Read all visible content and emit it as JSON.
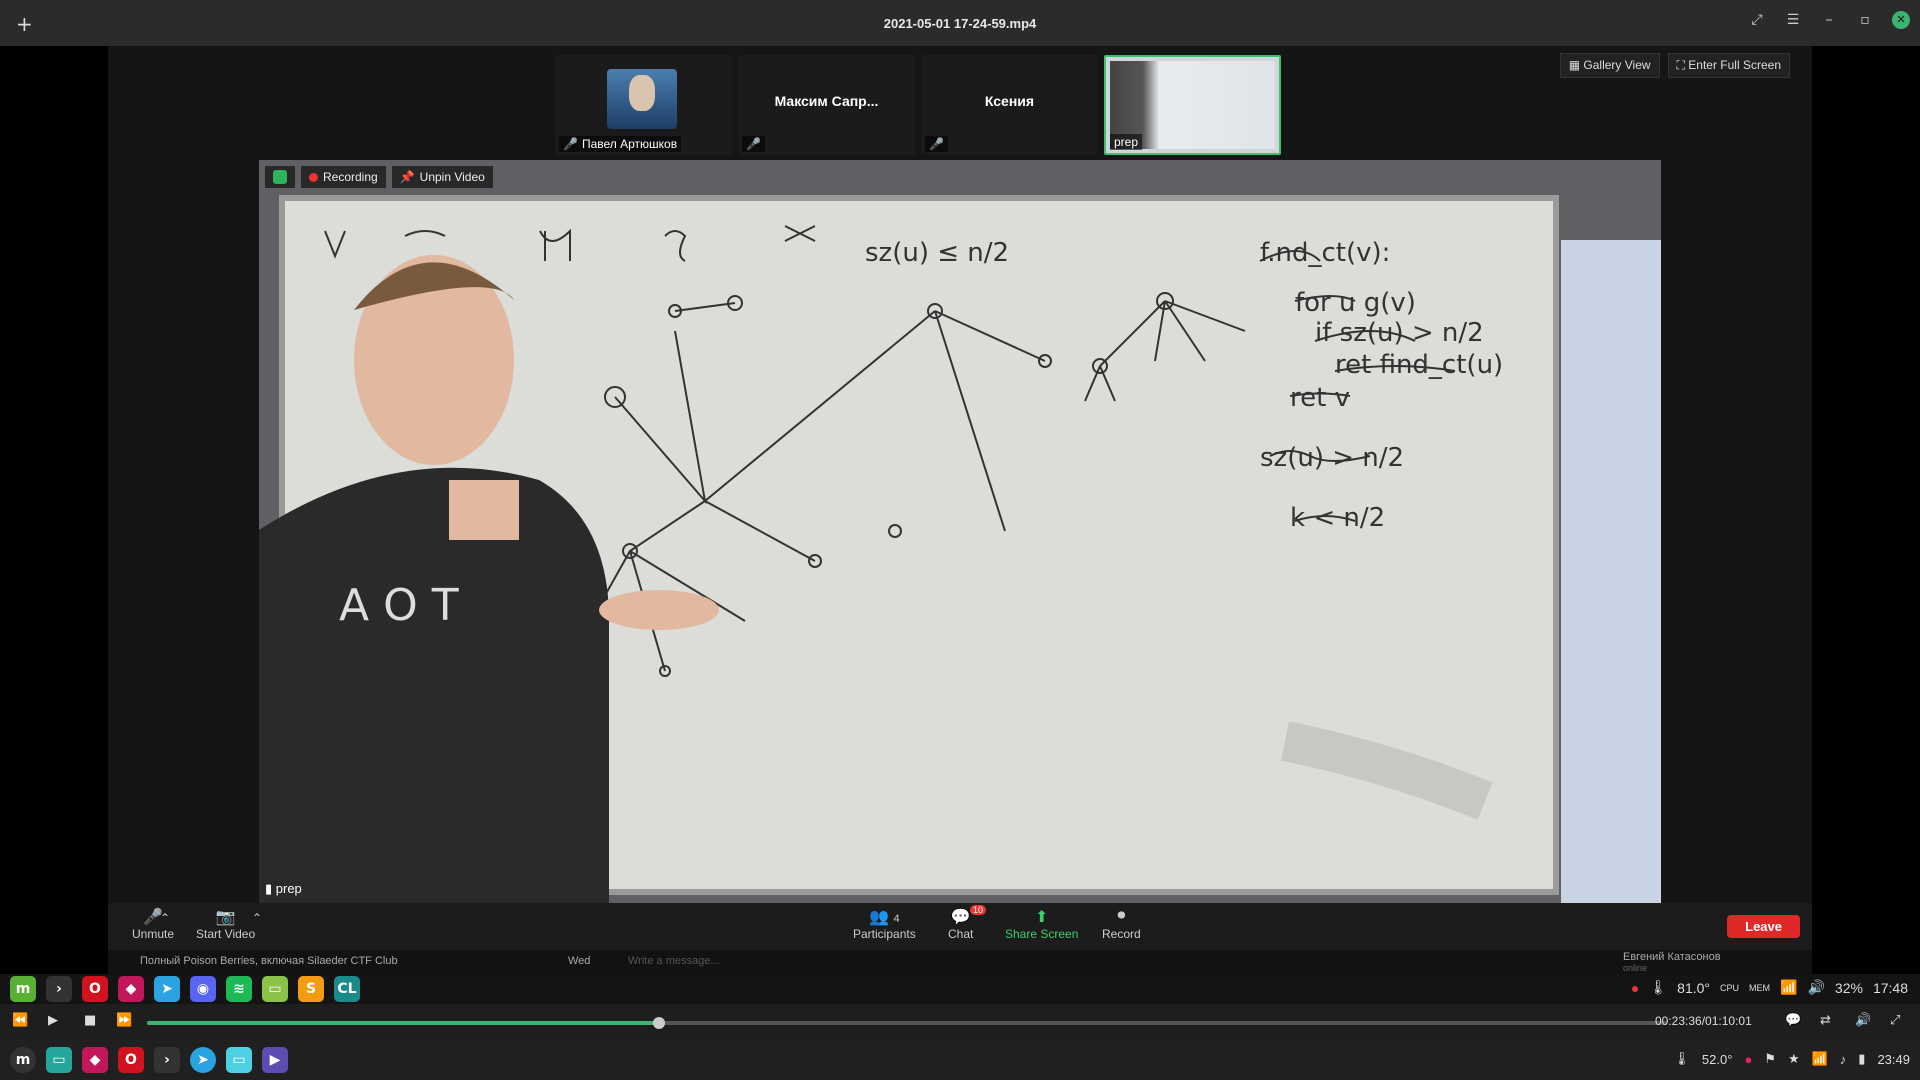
{
  "window": {
    "title": "2021-05-01 17-24-59.mp4"
  },
  "participants_strip": [
    {
      "caption": "Павел Артюшков",
      "name": ""
    },
    {
      "caption": "",
      "name": "Максим Сапр..."
    },
    {
      "caption": "",
      "name": "Ксения"
    },
    {
      "caption": "prep",
      "name": ""
    }
  ],
  "view_buttons": {
    "gallery": "Gallery View",
    "fullscreen": "Enter Full Screen"
  },
  "main_video": {
    "recording": "Recording",
    "unpin": "Unpin Video",
    "speaker": "prep"
  },
  "controls": {
    "unmute": "Unmute",
    "start_video": "Start Video",
    "participants": "Participants",
    "participants_count": "4",
    "chat": "Chat",
    "chat_badge": "10",
    "share_screen": "Share Screen",
    "record": "Record",
    "leave": "Leave"
  },
  "chat_strip": {
    "group": "Полный Poison Berries, включая Silaeder CTF Club",
    "day": "Wed",
    "placeholder": "Write a message...",
    "contact": "Евгений Катасонов",
    "contact_status": "online"
  },
  "system_tray_top": {
    "temp": "81.0°",
    "cpu": "CPU",
    "mem": "MEM",
    "battery": "32%",
    "clock": "17:48"
  },
  "player": {
    "time": "00:23:36/01:10:01",
    "progress": 0.337
  },
  "system_tray_bottom": {
    "temp": "52.0°",
    "clock": "23:49"
  }
}
